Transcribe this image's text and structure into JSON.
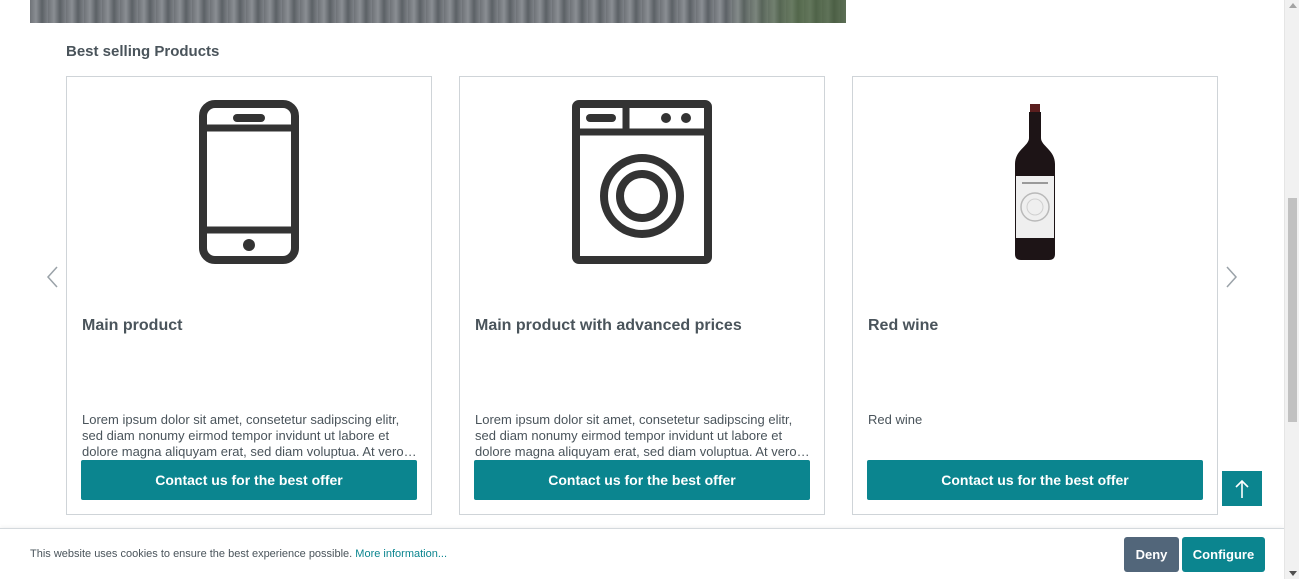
{
  "section": {
    "title": "Best selling Products"
  },
  "slider": {
    "prev_icon": "chevron-left-icon",
    "next_icon": "chevron-right-icon"
  },
  "products": [
    {
      "title": "Main product",
      "icon": "smartphone-icon",
      "description": "Lorem ipsum dolor sit amet, consetetur sadipscing elitr, sed diam nonumy eirmod tempor invidunt ut labore et dolore magna aliquyam erat, sed diam voluptua. At vero eos et…",
      "button": "Contact us for the best offer"
    },
    {
      "title": "Main product with advanced prices",
      "icon": "washing-machine-icon",
      "description": "Lorem ipsum dolor sit amet, consetetur sadipscing elitr, sed diam nonumy eirmod tempor invidunt ut labore et dolore magna aliquyam erat, sed diam voluptua. At vero eos et…",
      "button": "Contact us for the best offer"
    },
    {
      "title": "Red wine",
      "icon": "wine-bottle-icon",
      "description": "Red wine",
      "button": "Contact us for the best offer"
    }
  ],
  "back_to_top": {
    "icon": "arrow-up-icon"
  },
  "cookie": {
    "text": "This website uses cookies to ensure the best experience possible.",
    "link": "More information...",
    "deny": "Deny",
    "configure": "Configure"
  },
  "colors": {
    "accent": "#0b858f",
    "deny": "#52667a",
    "text": "#4a545b",
    "border": "#cfd4d8"
  }
}
